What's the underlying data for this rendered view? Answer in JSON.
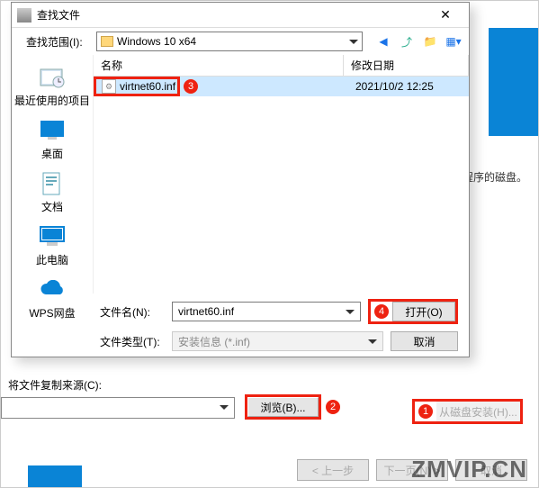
{
  "file_dialog": {
    "title": "查找文件",
    "lookin_label": "查找范围(I):",
    "current_folder": "Windows 10 x64",
    "columns": {
      "name": "名称",
      "modified": "修改日期"
    },
    "files": [
      {
        "name": "virtnet60.inf",
        "modified": "2021/10/2 12:25"
      }
    ],
    "filename_label": "文件名(N):",
    "filename_value": "virtnet60.inf",
    "filetype_label": "文件类型(T):",
    "filetype_value": "安装信息 (*.inf)",
    "open_label": "打开(O)",
    "cancel_label": "取消",
    "sidebar": {
      "recent": "最近使用的项目",
      "desktop": "桌面",
      "documents": "文档",
      "thispc": "此电脑",
      "wps": "WPS网盘"
    }
  },
  "background": {
    "disk_hint": "程序的磁盘。",
    "copy_source_label": "将文件复制来源(C):",
    "browse_label": "浏览(B)...",
    "disk_install_label": "从磁盘安装(H)...",
    "prev_label": "< 上一步",
    "next_label": "下一页(N) >",
    "cancel_label": "取消"
  },
  "annotations": {
    "b1": "1",
    "b2": "2",
    "b3": "3",
    "b4": "4"
  },
  "watermark": "ZMVIP.CN"
}
